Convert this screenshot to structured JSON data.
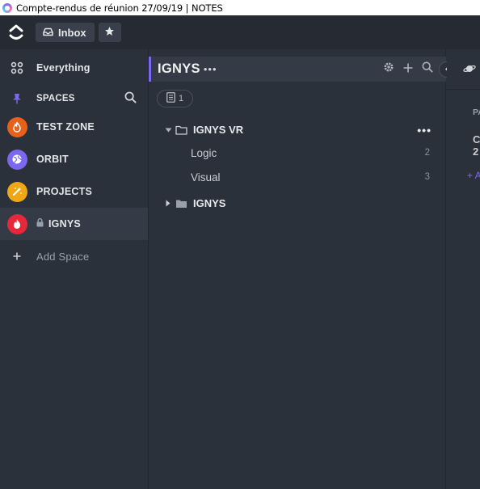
{
  "window": {
    "title": "Compte-rendus de réunion 27/09/19 | NOTES"
  },
  "topbar": {
    "inbox_label": "Inbox"
  },
  "sidebar": {
    "everything_label": "Everything",
    "spaces_label": "SPACES",
    "spaces": [
      {
        "label": "TEST ZONE",
        "color": "#e8611b",
        "icon": "flame-icon"
      },
      {
        "label": "ORBIT",
        "color": "#7b68ee",
        "icon": "globe-icon"
      },
      {
        "label": "PROJECTS",
        "color": "#f0a715",
        "icon": "magic-wand-icon"
      },
      {
        "label": "IGNYS",
        "color": "#e5283a",
        "icon": "flame-icon",
        "locked": true,
        "active": true
      }
    ],
    "add_space_label": "Add Space"
  },
  "panel": {
    "title": "IGNYS",
    "title_dots": "•••",
    "doc_count": "1",
    "folders": [
      {
        "name": "IGNYS VR",
        "expanded": true,
        "more": "•••",
        "lists": [
          {
            "name": "Logic",
            "count": "2"
          },
          {
            "name": "Visual",
            "count": "3"
          }
        ]
      },
      {
        "name": "IGNYS",
        "expanded": false
      }
    ]
  },
  "right": {
    "frag_pa": "PA",
    "frag_c": "C",
    "frag_2": "2",
    "frag_add": "+ A"
  },
  "colors": {
    "accent": "#7b68ee",
    "background": "#2b313b",
    "topbar": "#262b33"
  }
}
